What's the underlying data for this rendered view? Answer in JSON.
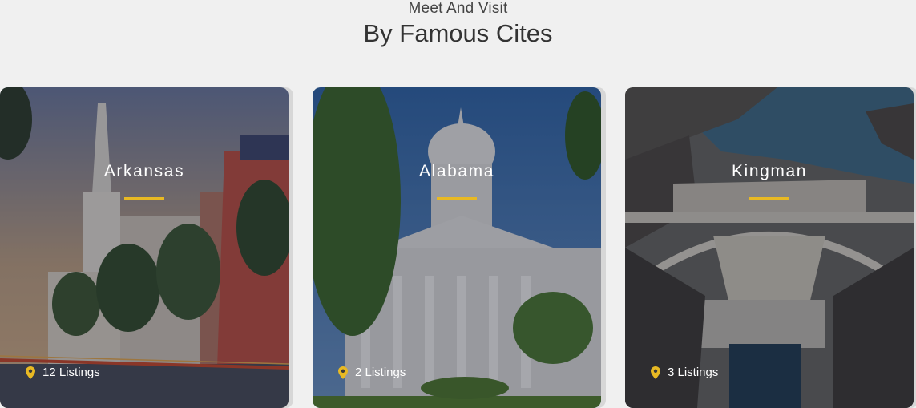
{
  "header": {
    "subtitle": "Meet And Visit",
    "title": "By Famous Cites"
  },
  "cities": [
    {
      "name": "Arkansas",
      "listings": "12 Listings"
    },
    {
      "name": "Alabama",
      "listings": "2 Listings"
    },
    {
      "name": "Kingman",
      "listings": "3 Listings"
    }
  ],
  "colors": {
    "accent": "#e8b923",
    "background": "#f0f0f0"
  },
  "icons": {
    "listing": "map-pin-icon"
  }
}
